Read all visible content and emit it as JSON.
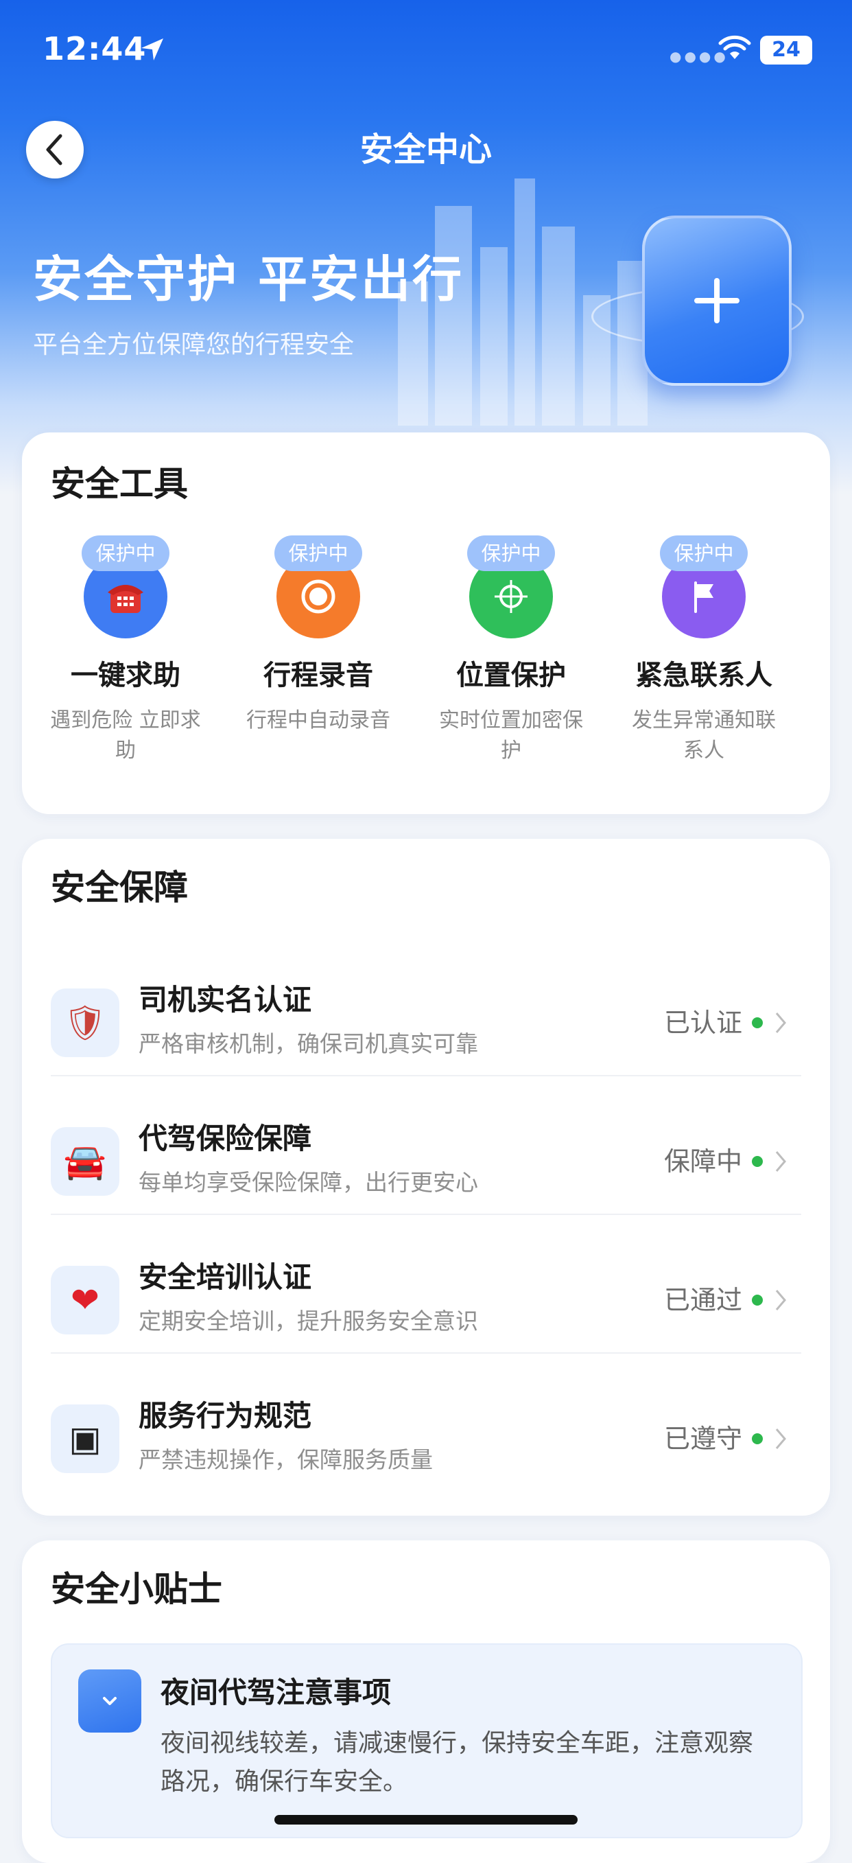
{
  "status_bar": {
    "time": "12:44",
    "battery": "24"
  },
  "header": {
    "title": "安全中心"
  },
  "hero": {
    "title": "安全守护 平安出行",
    "subtitle": "平台全方位保障您的行程安全"
  },
  "tools": {
    "title": "安全工具",
    "items": [
      {
        "badge": "保护中",
        "name": "一键求助",
        "desc": "遇到危险 立即求助",
        "icon": "telephone-icon",
        "color": "#3f7cf3"
      },
      {
        "badge": "保护中",
        "name": "行程录音",
        "desc": "行程中自动录音",
        "icon": "record-icon",
        "color": "#f57b2b"
      },
      {
        "badge": "保护中",
        "name": "位置保护",
        "desc": "实时位置加密保护",
        "icon": "crosshair-icon",
        "color": "#2fbf5a"
      },
      {
        "badge": "保护中",
        "name": "紧急联系人",
        "desc": "发生异常通知联系人",
        "icon": "flag-icon",
        "color": "#8a5cf0"
      }
    ]
  },
  "guarantee": {
    "title": "安全保障",
    "items": [
      {
        "title": "司机实名认证",
        "desc": "严格审核机制，确保司机真实可靠",
        "status": "已认证",
        "icon": "shield-icon",
        "glyph": "🛡"
      },
      {
        "title": "代驾保险保障",
        "desc": "每单均享受保险保障，出行更安心",
        "status": "保障中",
        "icon": "car-icon",
        "glyph": "🚘"
      },
      {
        "title": "安全培训认证",
        "desc": "定期安全培训，提升服务安全意识",
        "status": "已通过",
        "icon": "heart-icon",
        "glyph": "❤"
      },
      {
        "title": "服务行为规范",
        "desc": "严禁违规操作，保障服务质量",
        "status": "已遵守",
        "icon": "square-icon",
        "glyph": "▣"
      }
    ],
    "status_color": "#2db84d"
  },
  "tips": {
    "title": "安全小贴士",
    "item": {
      "title": "夜间代驾注意事项",
      "body": "夜间视线较差，请减速慢行，保持安全车距，注意观察路况，确保行车安全。",
      "icon": "chevron-down-icon"
    }
  },
  "colors": {
    "brand": "#1f6cf2",
    "accent_green": "#2db84d"
  }
}
